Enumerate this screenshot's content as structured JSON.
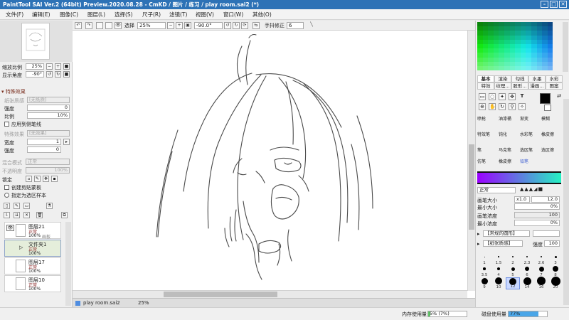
{
  "window": {
    "title": "PaintTool SAI Ver.2 (64bit) Preview.2020.08.28 - CmKD / 图片 / 练习 / play room.sai2 (*)",
    "min_label": "–",
    "max_label": "□",
    "close_label": "✕"
  },
  "menu": {
    "items": [
      {
        "label": "文件(F)"
      },
      {
        "label": "编辑(E)"
      },
      {
        "label": "图像(C)"
      },
      {
        "label": "图层(L)"
      },
      {
        "label": "选择(S)"
      },
      {
        "label": "尺子(R)"
      },
      {
        "label": "滤镜(T)"
      },
      {
        "label": "视图(V)"
      },
      {
        "label": "窗口(W)"
      },
      {
        "label": "其他(O)"
      }
    ]
  },
  "toolbar": {
    "select_label": "选择",
    "zoom_value": "25%",
    "rotation_value": "-90.0°",
    "stabilizer_label": "手抖修正",
    "stabilizer_value": "6"
  },
  "navigator": {
    "zoom_label": "缩放比例",
    "zoom_value": "25%",
    "angle_label": "显示角度",
    "angle_value": "-90°"
  },
  "effects": {
    "header": "特殊效果",
    "paper_label": "纸张质感",
    "paper_value": "[无纸质]",
    "strength_label": "强度",
    "strength_value": "0",
    "scale_label": "比例",
    "scale_value": "10%",
    "apply_label": "应用到侧笔线",
    "effect_label": "特殊效果",
    "effect_value": "[无效果]",
    "width_label": "宽度",
    "width_value": "1",
    "strength2_label": "强度",
    "strength2_value": "0"
  },
  "layer_props": {
    "blend_label": "混合模式",
    "blend_value": "正常",
    "opacity_label": "不透明度",
    "opacity_value": "100%",
    "lock_label": "锁定",
    "clip_label": "创建剪贴蒙板",
    "sample_label": "指定为选区样本"
  },
  "layers": [
    {
      "name": "图层21",
      "mode": "正常",
      "opacity": "100%",
      "tag": "画板"
    },
    {
      "name": "文件夹1",
      "mode": "正常",
      "opacity": "100%"
    },
    {
      "name": "图层17",
      "mode": "正常",
      "opacity": "100%"
    },
    {
      "name": "图层10",
      "mode": "正常",
      "opacity": "100%"
    }
  ],
  "color_tabs": {
    "row1": [
      {
        "label": "基本"
      },
      {
        "label": "渲染"
      },
      {
        "label": "勾线"
      },
      {
        "label": "水墨"
      },
      {
        "label": "水彩"
      }
    ],
    "row2": [
      {
        "label": "特效"
      },
      {
        "label": "纹理..."
      },
      {
        "label": "股形..."
      },
      {
        "label": "漫画..."
      },
      {
        "label": "图案"
      }
    ]
  },
  "brushes": [
    {
      "label": "喷枪"
    },
    {
      "label": "油漆桶"
    },
    {
      "label": "渐变"
    },
    {
      "label": "模糊"
    },
    {
      "label": "特效笔"
    },
    {
      "label": "钝化"
    },
    {
      "label": "水彩笔"
    },
    {
      "label": "橡皮擦"
    },
    {
      "label": "笔"
    },
    {
      "label": "马克笔"
    },
    {
      "label": "选区笔"
    },
    {
      "label": "选区擦"
    },
    {
      "label": "仿笔"
    },
    {
      "label": "橡皮擦"
    },
    {
      "label": "铅笔"
    }
  ],
  "brush_settings": {
    "blend_value": "正常",
    "size_label": "画笔大小",
    "size_mult": "x1.0",
    "size_value": "12.0",
    "min_size_label": "最小大小",
    "min_size_value": "0%",
    "density_label": "画笔浓度",
    "density_value": "100",
    "min_density_label": "最小浓度",
    "min_density_value": "0%",
    "shape_value": "【常规的圆形】",
    "texture_value": "【纸张质感】",
    "texture_strength_label": "强度",
    "texture_strength_value": "100"
  },
  "size_presets": [
    {
      "label": "1"
    },
    {
      "label": "1.5"
    },
    {
      "label": "2"
    },
    {
      "label": "2.3"
    },
    {
      "label": "2.6"
    },
    {
      "label": "3"
    },
    {
      "label": "3.5"
    },
    {
      "label": "4"
    },
    {
      "label": "5"
    },
    {
      "label": "6"
    },
    {
      "label": "7"
    },
    {
      "label": "8"
    },
    {
      "label": "9"
    },
    {
      "label": "10"
    },
    {
      "label": "12"
    },
    {
      "label": "14"
    },
    {
      "label": "16"
    },
    {
      "label": "20"
    }
  ],
  "canvas_tab": {
    "name": "play room.sai2",
    "zoom": "25%"
  },
  "status": {
    "memory_label": "内存使用量",
    "memory_value": "5% (7%)",
    "disk_label": "磁盘使用量",
    "disk_value": "77%"
  },
  "colors": {
    "title_bar": "#2d72b6",
    "current_brush": "#3b5cd1",
    "gradient_start": "#9b00ff",
    "gradient_end": "#25f2c3"
  }
}
